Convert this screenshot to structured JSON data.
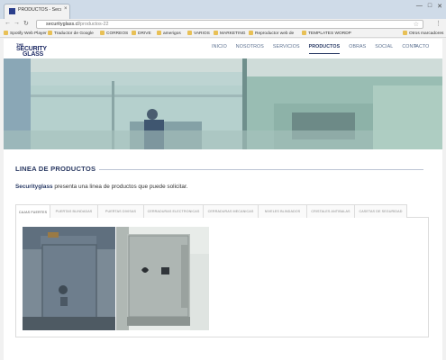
{
  "browser": {
    "tab_title": "PRODUCTOS - Security",
    "tab_close": "×",
    "win_buttons": [
      "—",
      "□",
      "✕"
    ],
    "url_domain": "securityglass.cl",
    "url_path": "/productos-22",
    "bookmarks": [
      "Spotify Web Player",
      "Traductor de Google",
      "CORREOS",
      "DRIVE",
      "amerigos",
      "VARIOS",
      "MARKETING",
      "Reproductor web de",
      "TEMPLATES WORDP",
      "Otros marcadores"
    ]
  },
  "site": {
    "logo_top": "THE",
    "logo_name_1": "SECURITY",
    "logo_name_2": "GLASS",
    "nav": [
      "INICIO",
      "NOSOTROS",
      "SERVICIOS",
      "PRODUCTOS",
      "OBRAS",
      "SOCIAL",
      "CONTACTO"
    ],
    "nav_active": "PRODUCTOS"
  },
  "content": {
    "section_title": "LINEA DE PRODUCTOS",
    "intro_brand": "Securityglass",
    "intro_text": " presenta una linea de productos que puede solicitar.",
    "tabs": [
      "CAJAS FUERTES",
      "PUERTAS BLINDADAS",
      "PUERTAS DIVISAS",
      "CERRADURAS ELECTRONICAS",
      "CERRADURAS MECANICAS",
      "NIVELES BLINDADOS",
      "CRISTALES ANTIBALAS",
      "CASETAS DE SEGURIDAD"
    ],
    "active_tab": "CAJAS FUERTES"
  },
  "colors": {
    "brand": "#2a3b66",
    "nav_text": "#5a6f8f",
    "chrome": "#cfdbe8"
  }
}
